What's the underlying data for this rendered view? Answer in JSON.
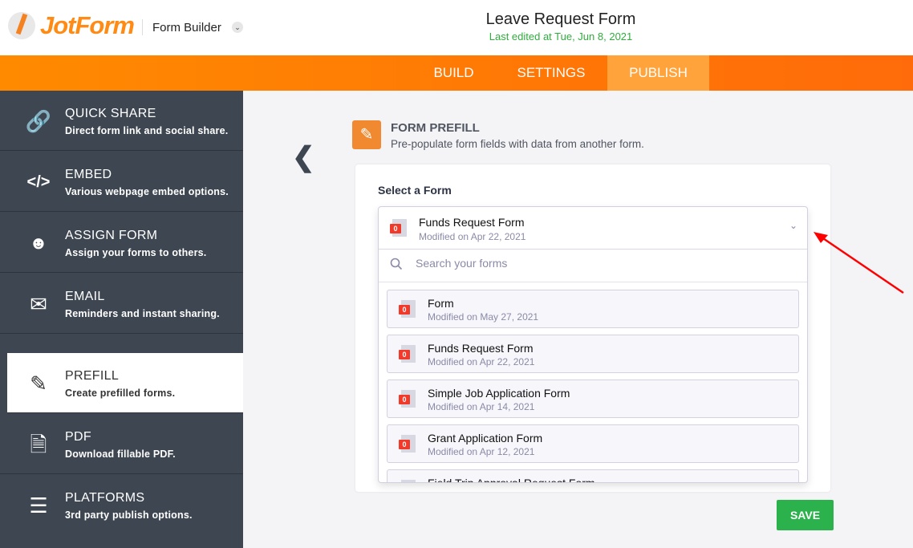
{
  "header": {
    "brand": "JotForm",
    "app_menu": "Form Builder",
    "title": "Leave Request Form",
    "subtitle": "Last edited at Tue, Jun 8, 2021"
  },
  "nav": {
    "tabs": [
      {
        "label": "BUILD"
      },
      {
        "label": "SETTINGS"
      },
      {
        "label": "PUBLISH",
        "active": true
      }
    ]
  },
  "sidebar": {
    "items": [
      {
        "label": "QUICK SHARE",
        "desc": "Direct form link and social share.",
        "icon": "link-icon"
      },
      {
        "label": "EMBED",
        "desc": "Various webpage embed options.",
        "icon": "code-icon"
      },
      {
        "label": "ASSIGN FORM",
        "desc": "Assign your forms to others.",
        "icon": "users-icon"
      },
      {
        "label": "EMAIL",
        "desc": "Reminders and instant sharing.",
        "icon": "envelope-icon"
      },
      {
        "label": "PREFILL",
        "desc": "Create prefilled forms.",
        "icon": "pencil-icon",
        "active": true
      },
      {
        "label": "PDF",
        "desc": "Download fillable PDF.",
        "icon": "pdf-icon"
      },
      {
        "label": "PLATFORMS",
        "desc": "3rd party publish options.",
        "icon": "layers-icon"
      }
    ]
  },
  "main": {
    "section_title": "FORM PREFILL",
    "section_desc": "Pre-populate form fields with data from another form.",
    "select_label": "Select a Form",
    "selected": {
      "name": "Funds Request Form",
      "modified": "Modified on Apr 22, 2021",
      "badge": "0"
    },
    "search_placeholder": "Search your forms",
    "forms": [
      {
        "name": "Form",
        "modified": "Modified on May 27, 2021",
        "badge": "0"
      },
      {
        "name": "Funds Request Form",
        "modified": "Modified on Apr 22, 2021",
        "badge": "0"
      },
      {
        "name": "Simple Job Application Form",
        "modified": "Modified on Apr 14, 2021",
        "badge": "0"
      },
      {
        "name": "Grant Application Form",
        "modified": "Modified on Apr 12, 2021",
        "badge": "0"
      },
      {
        "name": "Field Trip Approval Request Form",
        "modified": "",
        "badge": ""
      }
    ],
    "save_label": "SAVE"
  },
  "colors": {
    "accent": "#ff8a00",
    "sidebar": "#3e4652",
    "save": "#2bb24c",
    "annotation_arrow": "#ff0000"
  }
}
